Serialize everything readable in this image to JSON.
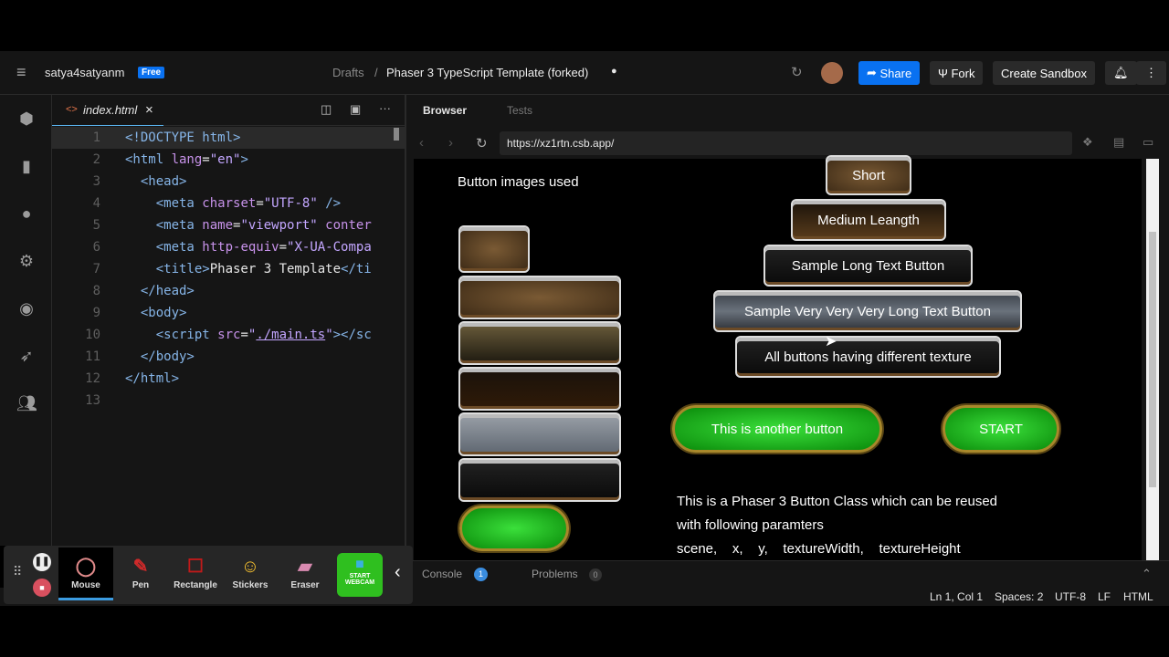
{
  "topbar": {
    "user": "satya4satyanm",
    "plan": "Free",
    "breadcrumb_parent": "Drafts",
    "sep": "/",
    "title": "Phaser 3 TypeScript Template (forked)",
    "share": "Share",
    "fork": "Fork",
    "create": "Create Sandbox"
  },
  "editor": {
    "tab": "index.html",
    "close": "×",
    "lines": [
      [
        [
          "<!DOCTYPE html>",
          "tg"
        ]
      ],
      [
        [
          "<html ",
          "tg"
        ],
        [
          "lang",
          "at"
        ],
        [
          "=",
          "pl"
        ],
        [
          "\"en\"",
          "st"
        ],
        [
          ">",
          "tg"
        ]
      ],
      [
        [
          "  <head>",
          "tg"
        ]
      ],
      [
        [
          "    <meta ",
          "tg"
        ],
        [
          "charset",
          "at"
        ],
        [
          "=",
          "pl"
        ],
        [
          "\"UTF-8\"",
          "st"
        ],
        [
          " />",
          "tg"
        ]
      ],
      [
        [
          "    <meta ",
          "tg"
        ],
        [
          "name",
          "at"
        ],
        [
          "=",
          "pl"
        ],
        [
          "\"viewport\"",
          "st"
        ],
        [
          " conter",
          "at"
        ]
      ],
      [
        [
          "    <meta ",
          "tg"
        ],
        [
          "http-equiv",
          "at"
        ],
        [
          "=",
          "pl"
        ],
        [
          "\"X-UA-Compa",
          "st"
        ]
      ],
      [
        [
          "    <title>",
          "tg"
        ],
        [
          "Phaser 3 Template",
          "pl"
        ],
        [
          "</ti",
          "tg"
        ]
      ],
      [
        [
          "  </head>",
          "tg"
        ]
      ],
      [
        [
          "  <body>",
          "tg"
        ]
      ],
      [
        [
          "    <script ",
          "tg"
        ],
        [
          "src",
          "at"
        ],
        [
          "=",
          "pl"
        ],
        [
          "\"",
          "st"
        ],
        [
          "./main.ts",
          "ut"
        ],
        [
          "\"",
          "st"
        ],
        [
          "></sc",
          "tg"
        ]
      ],
      [
        [
          "  </body>",
          "tg"
        ]
      ],
      [
        [
          "</html>",
          "tg"
        ]
      ],
      []
    ]
  },
  "preview": {
    "tab_browser": "Browser",
    "tab_tests": "Tests",
    "url": "https://xz1rtn.csb.app/"
  },
  "canvas": {
    "heading": "Button images used",
    "buttons": [
      "Short",
      "Medium Leangth",
      "Sample Long Text Button",
      "Sample Very Very Very Long Text Button",
      "All buttons having different texture"
    ],
    "green1": "This is another button",
    "green2": "START",
    "desc": [
      "This is a Phaser 3 Button Class which can be reused",
      "with following paramters",
      "scene,    x,    y,    textureWidth,    textureHeight"
    ]
  },
  "bottom": {
    "console": "Console",
    "console_count": "1",
    "problems": "Problems",
    "problems_count": "0"
  },
  "status": {
    "position": "Ln 1, Col 1",
    "spaces": "Spaces: 2",
    "encoding": "UTF-8",
    "eol": "LF",
    "lang": "HTML"
  },
  "recorder": {
    "tools": [
      "Mouse",
      "Pen",
      "Rectangle",
      "Stickers",
      "Eraser"
    ],
    "webcam": "START WEBCAM"
  },
  "colors": {
    "accent": "#0971f1",
    "green": "#2fbf1f"
  }
}
